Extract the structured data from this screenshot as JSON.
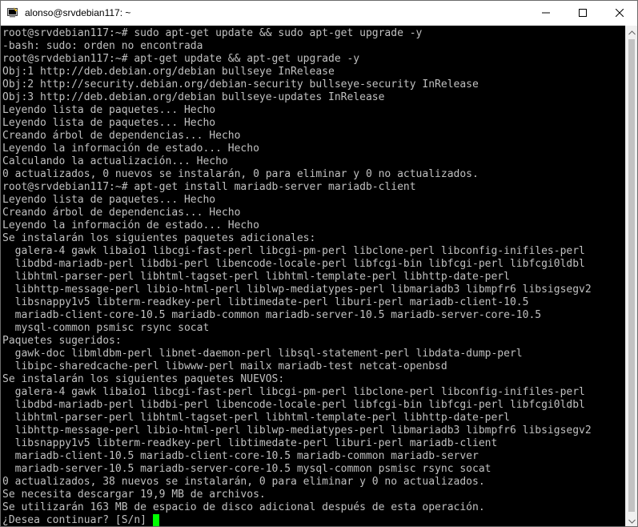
{
  "window": {
    "title": "alonso@srvdebian117: ~",
    "icon": "putty-terminal-icon"
  },
  "controls": {
    "minimize_icon": "minimize-icon",
    "maximize_icon": "maximize-icon",
    "close_icon": "close-icon"
  },
  "terminal": {
    "background": "#000000",
    "foreground": "#c0c0c0",
    "cursor_color": "#00ff00",
    "lines": [
      "root@srvdebian117:~# sudo apt-get update && sudo apt-get upgrade -y",
      "-bash: sudo: orden no encontrada",
      "root@srvdebian117:~# apt-get update && apt-get upgrade -y",
      "Obj:1 http://deb.debian.org/debian bullseye InRelease",
      "Obj:2 http://security.debian.org/debian-security bullseye-security InRelease",
      "Obj:3 http://deb.debian.org/debian bullseye-updates InRelease",
      "Leyendo lista de paquetes... Hecho",
      "Leyendo lista de paquetes... Hecho",
      "Creando árbol de dependencias... Hecho",
      "Leyendo la información de estado... Hecho",
      "Calculando la actualización... Hecho",
      "0 actualizados, 0 nuevos se instalarán, 0 para eliminar y 0 no actualizados.",
      "root@srvdebian117:~# apt-get install mariadb-server mariadb-client",
      "Leyendo lista de paquetes... Hecho",
      "Creando árbol de dependencias... Hecho",
      "Leyendo la información de estado... Hecho",
      "Se instalarán los siguientes paquetes adicionales:",
      "  galera-4 gawk libaio1 libcgi-fast-perl libcgi-pm-perl libclone-perl libconfig-inifiles-perl",
      "  libdbd-mariadb-perl libdbi-perl libencode-locale-perl libfcgi-bin libfcgi-perl libfcgi0ldbl",
      "  libhtml-parser-perl libhtml-tagset-perl libhtml-template-perl libhttp-date-perl",
      "  libhttp-message-perl libio-html-perl liblwp-mediatypes-perl libmariadb3 libmpfr6 libsigsegv2",
      "  libsnappy1v5 libterm-readkey-perl libtimedate-perl liburi-perl mariadb-client-10.5",
      "  mariadb-client-core-10.5 mariadb-common mariadb-server-10.5 mariadb-server-core-10.5",
      "  mysql-common psmisc rsync socat",
      "Paquetes sugeridos:",
      "  gawk-doc libmldbm-perl libnet-daemon-perl libsql-statement-perl libdata-dump-perl",
      "  libipc-sharedcache-perl libwww-perl mailx mariadb-test netcat-openbsd",
      "Se instalarán los siguientes paquetes NUEVOS:",
      "  galera-4 gawk libaio1 libcgi-fast-perl libcgi-pm-perl libclone-perl libconfig-inifiles-perl",
      "  libdbd-mariadb-perl libdbi-perl libencode-locale-perl libfcgi-bin libfcgi-perl libfcgi0ldbl",
      "  libhtml-parser-perl libhtml-tagset-perl libhtml-template-perl libhttp-date-perl",
      "  libhttp-message-perl libio-html-perl liblwp-mediatypes-perl libmariadb3 libmpfr6 libsigsegv2",
      "  libsnappy1v5 libterm-readkey-perl libtimedate-perl liburi-perl mariadb-client",
      "  mariadb-client-10.5 mariadb-client-core-10.5 mariadb-common mariadb-server",
      "  mariadb-server-10.5 mariadb-server-core-10.5 mysql-common psmisc rsync socat",
      "0 actualizados, 38 nuevos se instalarán, 0 para eliminar y 0 no actualizados.",
      "Se necesita descargar 19,9 MB de archivos.",
      "Se utilizarán 163 MB de espacio de disco adicional después de esta operación.",
      "¿Desea continuar? [S/n] "
    ]
  },
  "scrollbar": {
    "up_icon": "scroll-up-arrow-icon",
    "down_icon": "scroll-down-arrow-icon"
  }
}
